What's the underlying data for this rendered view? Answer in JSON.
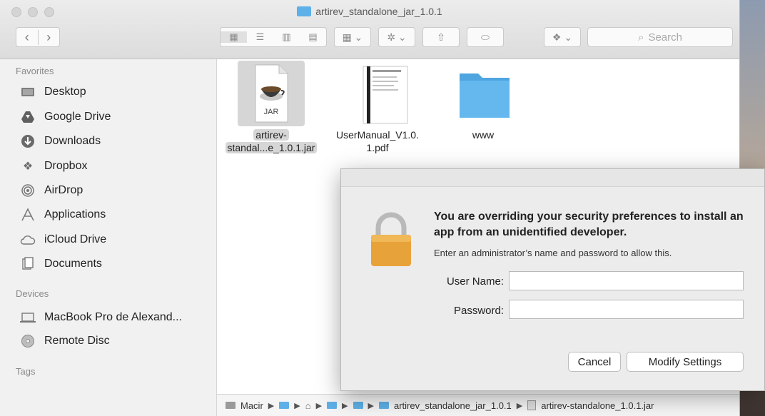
{
  "window": {
    "title": "artirev_standalone_jar_1.0.1"
  },
  "toolbar": {
    "back_glyph": "‹",
    "forward_glyph": "›",
    "search_placeholder": "Search"
  },
  "sidebar": {
    "favorites_heading": "Favorites",
    "favorites": [
      {
        "label": "Desktop",
        "icon": "desktop-icon"
      },
      {
        "label": "Google Drive",
        "icon": "google-drive-icon"
      },
      {
        "label": "Downloads",
        "icon": "downloads-icon"
      },
      {
        "label": "Dropbox",
        "icon": "dropbox-icon"
      },
      {
        "label": "AirDrop",
        "icon": "airdrop-icon"
      },
      {
        "label": "Applications",
        "icon": "applications-icon"
      },
      {
        "label": "iCloud Drive",
        "icon": "icloud-icon"
      },
      {
        "label": "Documents",
        "icon": "documents-icon"
      }
    ],
    "devices_heading": "Devices",
    "devices": [
      {
        "label": "MacBook Pro de Alexand...",
        "icon": "laptop-icon"
      },
      {
        "label": "Remote Disc",
        "icon": "disc-icon"
      }
    ],
    "tags_heading": "Tags"
  },
  "files": [
    {
      "label_line1": "artirev-",
      "label_line2": "standal...e_1.0.1.jar",
      "type": "jar",
      "badge": "JAR",
      "selected": true
    },
    {
      "label_line1": "UserManual_V1.0.",
      "label_line2": "1.pdf",
      "type": "pdf"
    },
    {
      "label_line1": "www",
      "label_line2": "",
      "type": "folder"
    }
  ],
  "pathbar": {
    "root": "Macir",
    "folder": "artirev_standalone_jar_1.0.1",
    "file": "artirev-standalone_1.0.1.jar"
  },
  "dialog": {
    "title": "You are overriding your security preferences to install an app from an unidentified developer.",
    "subtitle": "Enter an administrator’s name and password to allow this.",
    "username_label": "User Name:",
    "password_label": "Password:",
    "username_value": "",
    "password_value": "",
    "cancel_label": "Cancel",
    "confirm_label": "Modify Settings"
  },
  "colors": {
    "folder_blue": "#5db0e8",
    "lock_gold": "#e8a23a"
  }
}
